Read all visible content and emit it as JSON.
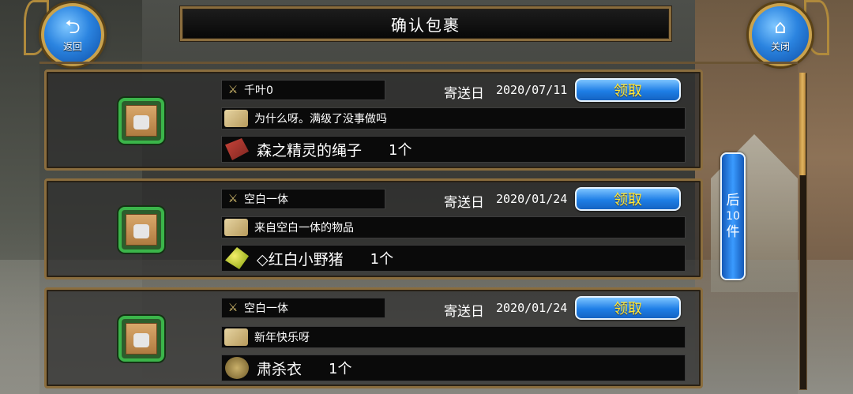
{
  "header": {
    "title": "确认包裹",
    "back_icon": "return-arrow-icon",
    "back_label": "返回",
    "close_icon": "house-icon",
    "close_label": "关闭"
  },
  "mails": [
    {
      "sender": "千叶0",
      "date_label": "寄送日",
      "date": "2020/07/11",
      "claim_label": "领取",
      "message": "为什么呀。满级了没事做吗",
      "item_name": "森之精灵的绳子",
      "item_qty": "1个",
      "item_icon": "rope-icon"
    },
    {
      "sender": "空白一体",
      "date_label": "寄送日",
      "date": "2020/01/24",
      "claim_label": "领取",
      "message": "来自空白一体的物品",
      "item_name": "◇红白小野猪",
      "item_qty": "1个",
      "item_icon": "leaf-icon"
    },
    {
      "sender": "空白一体",
      "date_label": "寄送日",
      "date": "2020/01/24",
      "claim_label": "领取",
      "message": "新年快乐呀",
      "item_name": "肃杀衣",
      "item_qty": "1个",
      "item_icon": "cloth-icon"
    }
  ],
  "next_page": {
    "line1": "后",
    "line2": "10",
    "line3": "件"
  },
  "colors": {
    "claim_text": "#ffe93b",
    "button_blue": "#1e7ee6",
    "frame_gold": "#8a6d3e",
    "icon_frame_green": "#3bb54a"
  }
}
